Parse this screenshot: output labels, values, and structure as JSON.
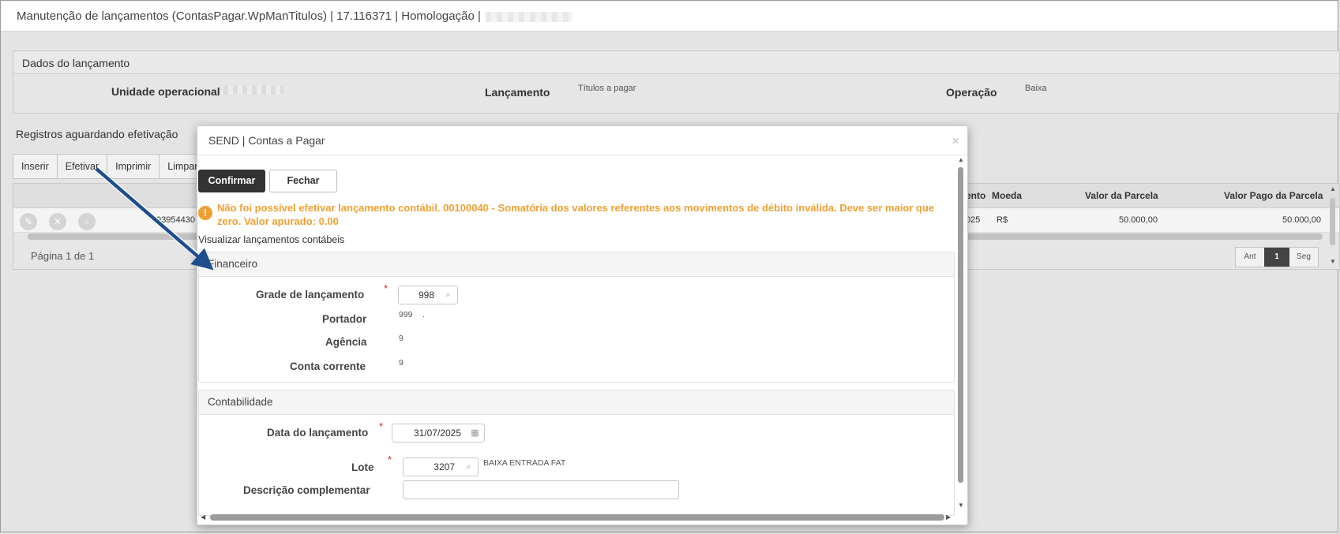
{
  "window": {
    "title": "Manutenção de lançamentos (ContasPagar.WpManTitulos) | 17.116371 | Homologação |"
  },
  "dados": {
    "heading": "Dados do lançamento",
    "unidade_label": "Unidade operacional",
    "lancamento_label": "Lançamento",
    "lancamento_value": "Títulos a pagar",
    "operacao_label": "Operação",
    "operacao_value": "Baixa"
  },
  "registros": {
    "caption": "Registros aguardando efetivação",
    "toolbar": [
      "Inserir",
      "Efetivar",
      "Imprimir",
      "Limpar"
    ],
    "columns": {
      "vencimento_partial": "ento",
      "moeda": "Moeda",
      "valor_parcela": "Valor da Parcela",
      "valor_pago": "Valor Pago da Parcela"
    },
    "row": {
      "id_partial": "93954430",
      "date_partial": "025",
      "moeda": "R$",
      "valor_parcela": "50.000,00",
      "valor_pago": "50.000,00"
    },
    "pager_text": "Página 1 de 1",
    "pager": {
      "prev": "Ant",
      "current": "1",
      "next": "Seg"
    }
  },
  "modal": {
    "title": "SEND | Contas a Pagar",
    "close": "×",
    "confirm_label": "Confirmar",
    "fechar_label": "Fechar",
    "warning": "Não foi possível efetivar lançamento contábil. 00100040 - Somatória dos valores referentes aos movimentos de débito inválida. Deve ser maior que zero. Valor apurado: 0.00",
    "view_link": "Visualizar lançamentos contábeis",
    "financeiro": {
      "heading": "Financeiro",
      "grade_label": "Grade de lançamento",
      "grade_value": "998",
      "portador_label": "Portador",
      "portador_value": "999",
      "portador_extra": ".",
      "agencia_label": "Agência",
      "agencia_value": "9",
      "conta_label": "Conta corrente",
      "conta_value": "9"
    },
    "contabilidade": {
      "heading": "Contabilidade",
      "data_label": "Data do lançamento",
      "data_value": "31/07/2025",
      "lote_label": "Lote",
      "lote_value": "3207",
      "lote_desc": "BAIXA ENTRADA FAT",
      "descricao_label": "Descrição complementar",
      "descricao_value": ""
    }
  },
  "colors": {
    "accent_warning": "#f0a030",
    "confirm_bg": "#333333",
    "arrow": "#1e4f8c",
    "required": "#e02020"
  }
}
